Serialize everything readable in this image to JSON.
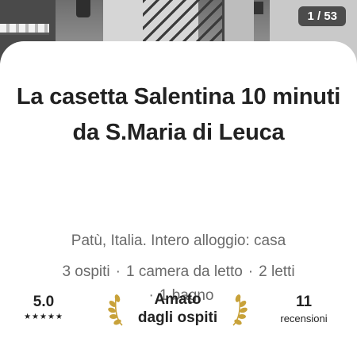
{
  "photo": {
    "counter": "1 / 53"
  },
  "listing": {
    "title": "La casetta Salentina 10 minuti da S.Maria di Leuca",
    "location_type": "Patù, Italia. Intero alloggio: casa",
    "details": [
      "3 ospiti",
      "1 camera da letto",
      "2 letti",
      "1 bagno"
    ],
    "separator": "·"
  },
  "stats": {
    "rating": "5.0",
    "stars": "★★★★★",
    "badge": {
      "line1": "Amato",
      "line2": "dagli ospiti",
      "icon": "laurel-icon",
      "color": "#c8a23a"
    },
    "reviews_count": "11",
    "reviews_label": "recensioni"
  }
}
